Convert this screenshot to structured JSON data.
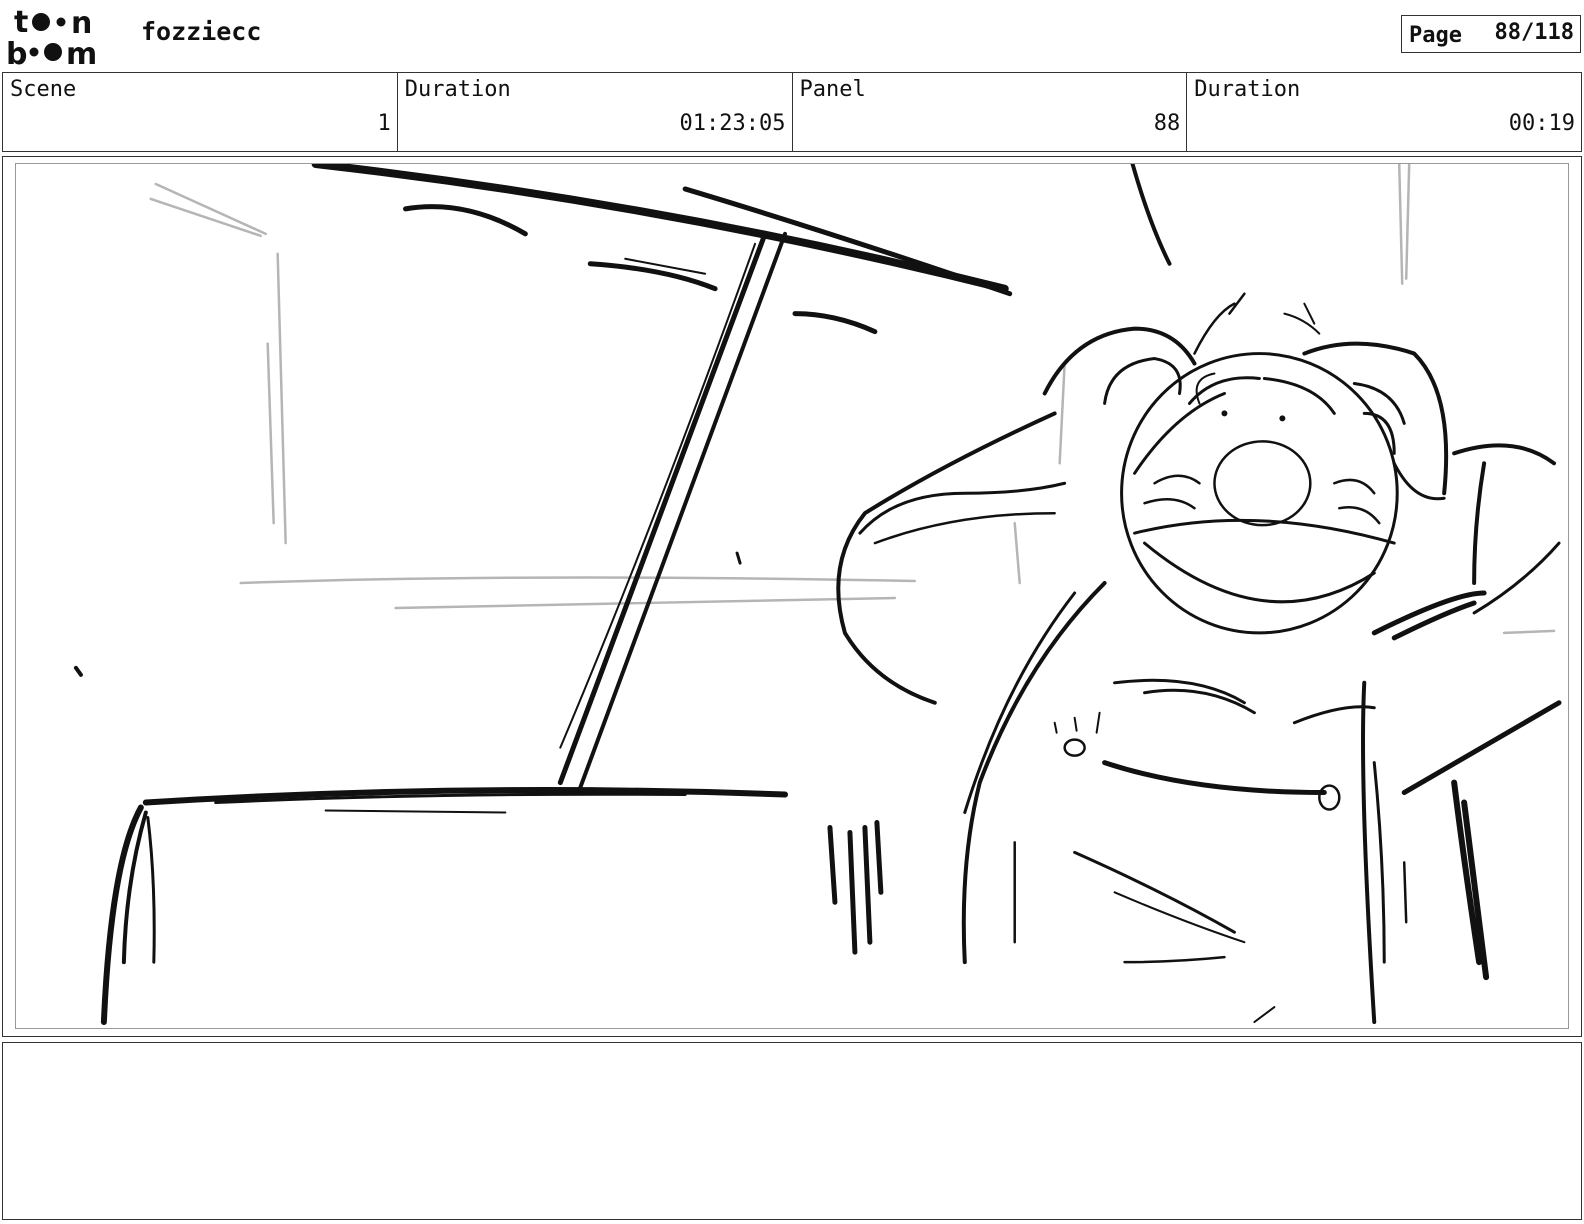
{
  "header": {
    "logo_text": "toon boom",
    "project_name": "fozziecc",
    "page_label": "Page",
    "page_value": "88/118"
  },
  "info": {
    "scene_label": "Scene",
    "scene_value": "1",
    "scene_duration_label": "Duration",
    "scene_duration_value": "01:23:05",
    "panel_label": "Panel",
    "panel_value": "88",
    "panel_duration_label": "Duration",
    "panel_duration_value": "00:19"
  },
  "colors": {
    "ink": "#111111",
    "construction": "#b5b5b5",
    "frame": "#333333"
  },
  "notes": {
    "text": ""
  }
}
